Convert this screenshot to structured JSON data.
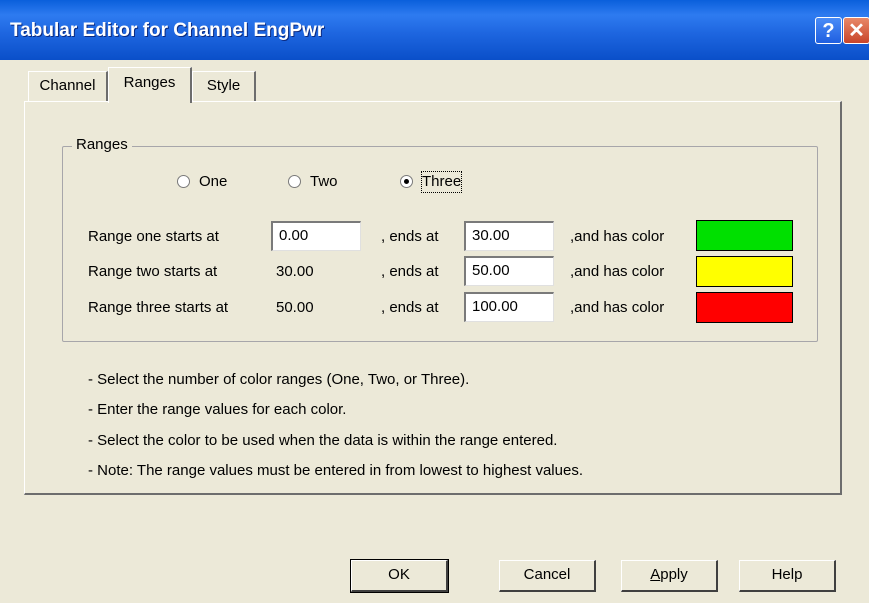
{
  "window": {
    "title": "Tabular Editor for Channel EngPwr",
    "help_glyph": "?",
    "close_glyph": "✕"
  },
  "tabs": {
    "channel": "Channel",
    "ranges": "Ranges",
    "style": "Style"
  },
  "ranges_group": {
    "label": "Ranges",
    "radios": [
      {
        "label": "One",
        "checked": false
      },
      {
        "label": "Two",
        "checked": false
      },
      {
        "label": "Three",
        "checked": true
      }
    ],
    "rows": [
      {
        "label": "Range one starts at",
        "start": "0.00",
        "ends_label": ", ends at",
        "end": "30.00",
        "color_label": ",and has color",
        "color": "#00E000"
      },
      {
        "label": "Range two starts at",
        "start": "30.00",
        "ends_label": ", ends at",
        "end": "50.00",
        "color_label": ",and has color",
        "color": "#FFFF00"
      },
      {
        "label": "Range three starts at",
        "start": "50.00",
        "ends_label": ", ends at",
        "end": "100.00",
        "color_label": ",and has color",
        "color": "#FF0000"
      }
    ]
  },
  "notes": [
    "- Select the number of color ranges (One, Two, or Three).",
    "- Enter the range values for each color.",
    "- Select the color to be used when the data is within the range entered.",
    "- Note: The range values must be entered in from lowest to highest values."
  ],
  "buttons": {
    "ok": "OK",
    "cancel": "Cancel",
    "apply": "Apply",
    "help": "Help"
  }
}
